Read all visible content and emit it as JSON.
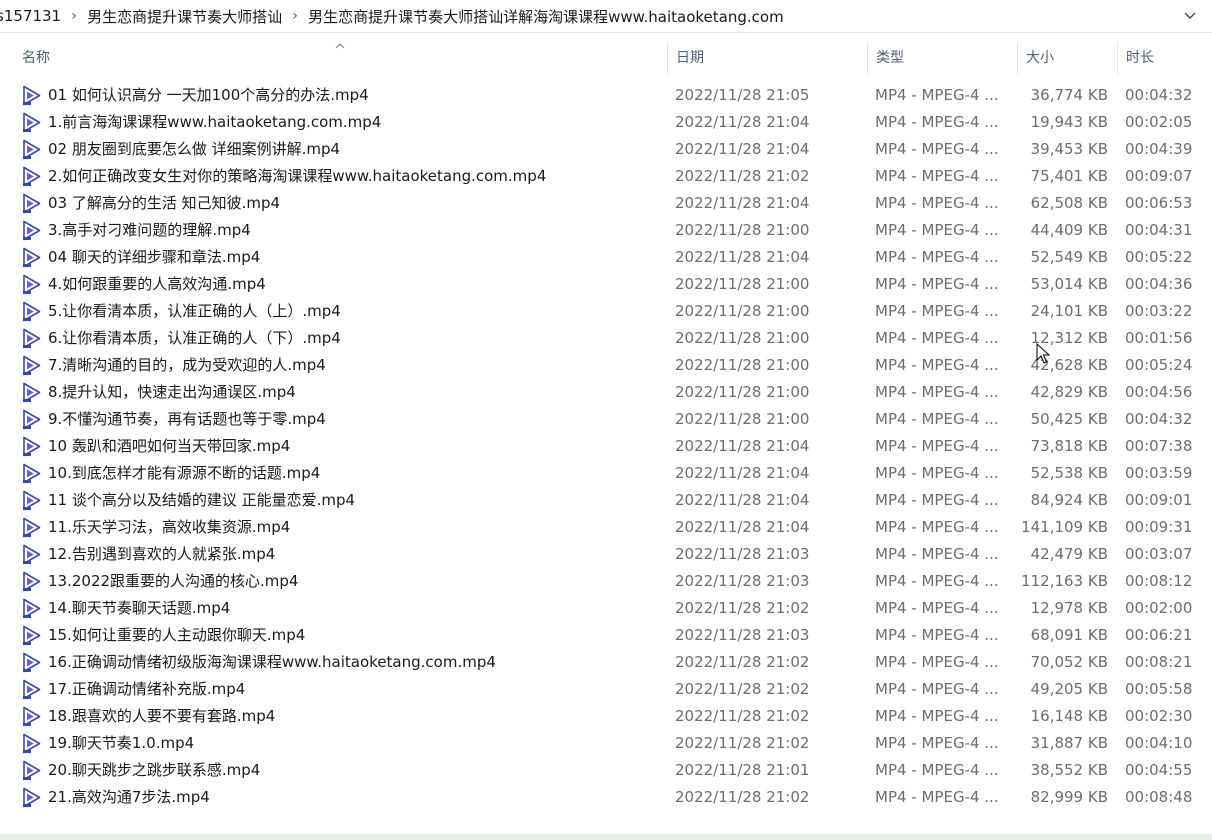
{
  "breadcrumb": {
    "items": [
      "s157131",
      "男生恋商提升课节奏大师搭讪",
      "男生恋商提升课节奏大师搭讪详解海淘课课程www.haitaoketang.com"
    ],
    "separator": "›"
  },
  "columns": {
    "name": "名称",
    "date": "日期",
    "type": "类型",
    "size": "大小",
    "duration": "时长"
  },
  "icons": {
    "file_icon": "video-file-icon",
    "sort": "sort-ascending-arrow-icon",
    "dropdown": "chevron-down-icon",
    "cursor": "mouse-pointer-icon"
  },
  "files": [
    {
      "name": "01 如何认识高分 一天加100个高分的办法.mp4",
      "date": "2022/11/28 21:05",
      "type": "MP4 - MPEG-4 ...",
      "size": "36,774 KB",
      "duration": "00:04:32"
    },
    {
      "name": "1.前言海淘课课程www.haitaoketang.com.mp4",
      "date": "2022/11/28 21:04",
      "type": "MP4 - MPEG-4 ...",
      "size": "19,943 KB",
      "duration": "00:02:05"
    },
    {
      "name": "02 朋友圈到底要怎么做 详细案例讲解.mp4",
      "date": "2022/11/28 21:04",
      "type": "MP4 - MPEG-4 ...",
      "size": "39,453 KB",
      "duration": "00:04:39"
    },
    {
      "name": "2.如何正确改变女生对你的策略海淘课课程www.haitaoketang.com.mp4",
      "date": "2022/11/28 21:02",
      "type": "MP4 - MPEG-4 ...",
      "size": "75,401 KB",
      "duration": "00:09:07"
    },
    {
      "name": "03 了解高分的生活 知己知彼.mp4",
      "date": "2022/11/28 21:04",
      "type": "MP4 - MPEG-4 ...",
      "size": "62,508 KB",
      "duration": "00:06:53"
    },
    {
      "name": "3.高手对刁难问题的理解.mp4",
      "date": "2022/11/28 21:00",
      "type": "MP4 - MPEG-4 ...",
      "size": "44,409 KB",
      "duration": "00:04:31"
    },
    {
      "name": "04 聊天的详细步骤和章法.mp4",
      "date": "2022/11/28 21:04",
      "type": "MP4 - MPEG-4 ...",
      "size": "52,549 KB",
      "duration": "00:05:22"
    },
    {
      "name": "4.如何跟重要的人高效沟通.mp4",
      "date": "2022/11/28 21:00",
      "type": "MP4 - MPEG-4 ...",
      "size": "53,014 KB",
      "duration": "00:04:36"
    },
    {
      "name": "5.让你看清本质，认准正确的人（上）.mp4",
      "date": "2022/11/28 21:00",
      "type": "MP4 - MPEG-4 ...",
      "size": "24,101 KB",
      "duration": "00:03:22"
    },
    {
      "name": "6.让你看清本质，认准正确的人（下）.mp4",
      "date": "2022/11/28 21:00",
      "type": "MP4 - MPEG-4 ...",
      "size": "12,312 KB",
      "duration": "00:01:56"
    },
    {
      "name": "7.清晰沟通的目的，成为受欢迎的人.mp4",
      "date": "2022/11/28 21:00",
      "type": "MP4 - MPEG-4 ...",
      "size": "42,628 KB",
      "duration": "00:05:24"
    },
    {
      "name": "8.提升认知，快速走出沟通误区.mp4",
      "date": "2022/11/28 21:00",
      "type": "MP4 - MPEG-4 ...",
      "size": "42,829 KB",
      "duration": "00:04:56"
    },
    {
      "name": "9.不懂沟通节奏，再有话题也等于零.mp4",
      "date": "2022/11/28 21:00",
      "type": "MP4 - MPEG-4 ...",
      "size": "50,425 KB",
      "duration": "00:04:32"
    },
    {
      "name": "10 轰趴和酒吧如何当天带回家.mp4",
      "date": "2022/11/28 21:04",
      "type": "MP4 - MPEG-4 ...",
      "size": "73,818 KB",
      "duration": "00:07:38"
    },
    {
      "name": "10.到底怎样才能有源源不断的话题.mp4",
      "date": "2022/11/28 21:04",
      "type": "MP4 - MPEG-4 ...",
      "size": "52,538 KB",
      "duration": "00:03:59"
    },
    {
      "name": "11 谈个高分以及结婚的建议 正能量恋爱.mp4",
      "date": "2022/11/28 21:04",
      "type": "MP4 - MPEG-4 ...",
      "size": "84,924 KB",
      "duration": "00:09:01"
    },
    {
      "name": "11.乐天学习法，高效收集资源.mp4",
      "date": "2022/11/28 21:04",
      "type": "MP4 - MPEG-4 ...",
      "size": "141,109 KB",
      "duration": "00:09:31"
    },
    {
      "name": "12.告别遇到喜欢的人就紧张.mp4",
      "date": "2022/11/28 21:03",
      "type": "MP4 - MPEG-4 ...",
      "size": "42,479 KB",
      "duration": "00:03:07"
    },
    {
      "name": "13.2022跟重要的人沟通的核心.mp4",
      "date": "2022/11/28 21:03",
      "type": "MP4 - MPEG-4 ...",
      "size": "112,163 KB",
      "duration": "00:08:12"
    },
    {
      "name": "14.聊天节奏聊天话题.mp4",
      "date": "2022/11/28 21:02",
      "type": "MP4 - MPEG-4 ...",
      "size": "12,978 KB",
      "duration": "00:02:00"
    },
    {
      "name": "15.如何让重要的人主动跟你聊天.mp4",
      "date": "2022/11/28 21:03",
      "type": "MP4 - MPEG-4 ...",
      "size": "68,091 KB",
      "duration": "00:06:21"
    },
    {
      "name": "16.正确调动情绪初级版海淘课课程www.haitaoketang.com.mp4",
      "date": "2022/11/28 21:02",
      "type": "MP4 - MPEG-4 ...",
      "size": "70,052 KB",
      "duration": "00:08:21"
    },
    {
      "name": "17.正确调动情绪补充版.mp4",
      "date": "2022/11/28 21:02",
      "type": "MP4 - MPEG-4 ...",
      "size": "49,205 KB",
      "duration": "00:05:58"
    },
    {
      "name": "18.跟喜欢的人要不要有套路.mp4",
      "date": "2022/11/28 21:02",
      "type": "MP4 - MPEG-4 ...",
      "size": "16,148 KB",
      "duration": "00:02:30"
    },
    {
      "name": "19.聊天节奏1.0.mp4",
      "date": "2022/11/28 21:02",
      "type": "MP4 - MPEG-4 ...",
      "size": "31,887 KB",
      "duration": "00:04:10"
    },
    {
      "name": "20.聊天跳步之跳步联系感.mp4",
      "date": "2022/11/28 21:01",
      "type": "MP4 - MPEG-4 ...",
      "size": "38,552 KB",
      "duration": "00:04:55"
    },
    {
      "name": "21.高效沟通7步法.mp4",
      "date": "2022/11/28 21:02",
      "type": "MP4 - MPEG-4 ...",
      "size": "82,999 KB",
      "duration": "00:08:48"
    }
  ]
}
